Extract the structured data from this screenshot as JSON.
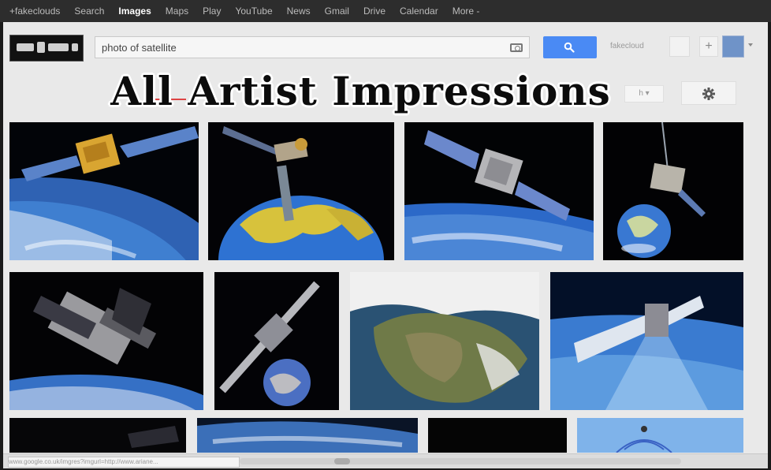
{
  "nav": {
    "items": [
      "+fakeclouds",
      "Search",
      "Images",
      "Maps",
      "Play",
      "YouTube",
      "News",
      "Gmail",
      "Drive",
      "Calendar",
      "More -"
    ],
    "active_index": 2
  },
  "search": {
    "query": "photo of satellite"
  },
  "account": {
    "username": "fakecloud"
  },
  "tools": {
    "safesearch": "h"
  },
  "overlay": {
    "caption": "All Artist Impressions"
  },
  "colors": {
    "search_button": "#4a8af4",
    "nav_bg": "#2d2d2d",
    "page_bg": "#e9e9e9",
    "overlay_text": "#0c0c0c"
  },
  "icons": {
    "search": "magnifier-icon",
    "camera": "camera-icon",
    "settings": "gear-icon",
    "share": "plus-icon"
  },
  "results": [
    {
      "subject": "satellite over earth"
    },
    {
      "subject": "satellite above globe"
    },
    {
      "subject": "satellite over earth horizon"
    },
    {
      "subject": "satellite with small globe"
    },
    {
      "subject": "space telescope over earth"
    },
    {
      "subject": "satellite with small globe"
    },
    {
      "subject": "satellite view of france"
    },
    {
      "subject": "satellite beaming over earth"
    },
    {
      "subject": "satellite dark"
    },
    {
      "subject": "earth horizon"
    },
    {
      "subject": "satellite dark"
    },
    {
      "subject": "satellite signal"
    }
  ],
  "status": {
    "url": "www.google.co.uk/imgres?imgurl=http://www.ariane..."
  }
}
